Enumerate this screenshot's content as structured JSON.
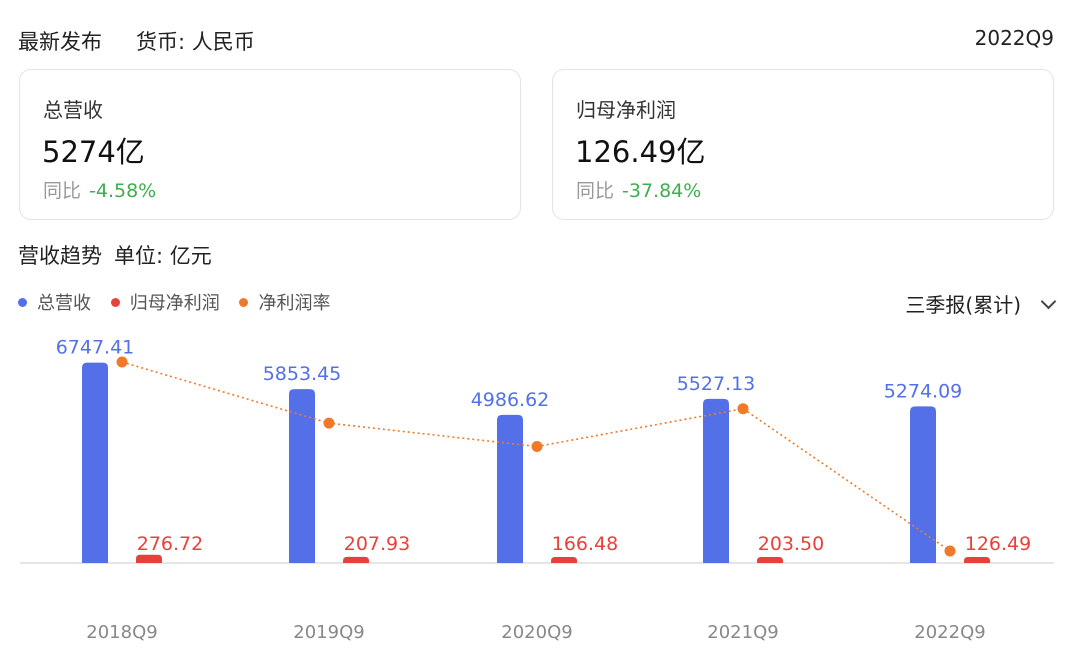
{
  "header": {
    "title": "最新发布",
    "currency": "货币: 人民币",
    "period": "2022Q9"
  },
  "cards": [
    {
      "label": "总营收",
      "value": "5274亿",
      "yoy_label": "同比",
      "yoy_value": "-4.58%"
    },
    {
      "label": "归母净利润",
      "value": "126.49亿",
      "yoy_label": "同比",
      "yoy_value": "-37.84%"
    }
  ],
  "trend": {
    "title": "营收趋势",
    "unit": "单位: 亿元"
  },
  "period_selector": {
    "label": "三季报(累计)"
  },
  "colors": {
    "revenue": "#5470e8",
    "profit": "#e8413c",
    "margin": "#f07a2a",
    "yoy_positive": "#3eae4e"
  },
  "chart_data": {
    "type": "bar",
    "categories": [
      "2018Q9",
      "2019Q9",
      "2020Q9",
      "2021Q9",
      "2022Q9"
    ],
    "series": [
      {
        "name": "总营收",
        "kind": "bar",
        "values": [
          6747.41,
          5853.45,
          4986.62,
          5527.13,
          5274.09
        ],
        "labels": [
          "6747.41",
          "5853.45",
          "4986.62",
          "5527.13",
          "5274.09"
        ]
      },
      {
        "name": "归母净利润",
        "kind": "bar",
        "values": [
          276.72,
          207.93,
          166.48,
          203.5,
          126.49
        ],
        "labels": [
          "276.72",
          "207.93",
          "166.48",
          "203.50",
          "126.49"
        ]
      },
      {
        "name": "净利润率",
        "kind": "line",
        "values": [
          4.1,
          3.55,
          3.34,
          3.68,
          2.4
        ]
      }
    ],
    "legend_position": "top-left",
    "grid": false
  }
}
